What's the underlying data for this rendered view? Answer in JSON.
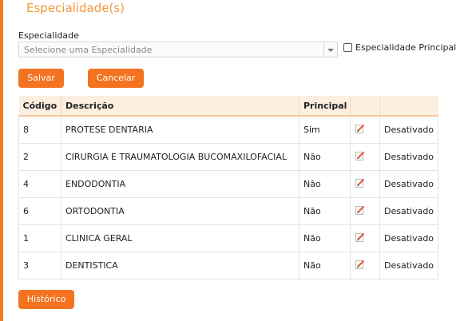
{
  "section": {
    "title": "Especialidade(s)"
  },
  "form": {
    "label": "Especialidade",
    "select_placeholder": "Selecione uma Especialidade",
    "principal_label": "Especialidade Principal"
  },
  "buttons": {
    "save": "Salvar",
    "cancel": "Cancelar",
    "history": "Histórico"
  },
  "table": {
    "headers": [
      "Código",
      "Descrição",
      "Principal",
      "",
      ""
    ],
    "rows": [
      {
        "codigo": "8",
        "descricao": "PROTESE DENTARIA",
        "principal": "Sim",
        "icon": "edit-icon",
        "status": "Desativado"
      },
      {
        "codigo": "2",
        "descricao": "CIRURGIA E TRAUMATOLOGIA BUCOMAXILOFACIAL",
        "principal": "Não",
        "icon": "edit-icon",
        "status": "Desativado"
      },
      {
        "codigo": "4",
        "descricao": "ENDODONTIA",
        "principal": "Não",
        "icon": "edit-icon",
        "status": "Desativado"
      },
      {
        "codigo": "6",
        "descricao": "ORTODONTIA",
        "principal": "Não",
        "icon": "edit-icon",
        "status": "Desativado"
      },
      {
        "codigo": "1",
        "descricao": "CLINICA GERAL",
        "principal": "Não",
        "icon": "edit-icon",
        "status": "Desativado"
      },
      {
        "codigo": "3",
        "descricao": "DENTISTICA",
        "principal": "Não",
        "icon": "edit-icon",
        "status": "Desativado"
      }
    ]
  },
  "colors": {
    "accent": "#f47321",
    "title": "#f39a3c",
    "header_bg": "#fdeee0"
  }
}
